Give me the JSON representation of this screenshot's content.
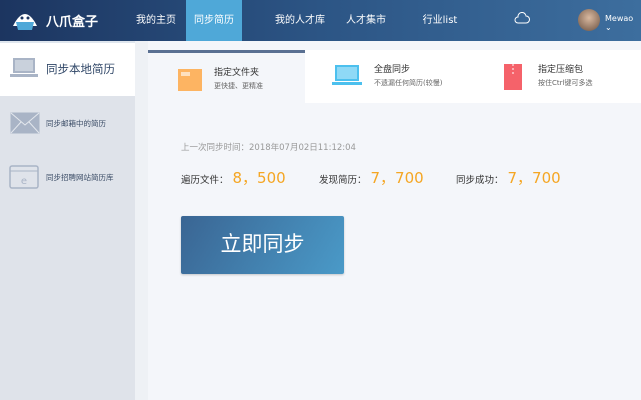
{
  "app": {
    "name": "八爪盒子"
  },
  "nav": [
    {
      "label": "我的主页"
    },
    {
      "label": "同步简历",
      "active": true
    },
    {
      "label": "我的人才库"
    },
    {
      "label": "人才集市"
    },
    {
      "label": "行业list"
    }
  ],
  "user": {
    "name": "Mewao"
  },
  "sidebar": {
    "title": "同步本地简历",
    "items": [
      {
        "label": "同步邮箱中的简历",
        "icon": "mail-icon"
      },
      {
        "label": "同步招聘网站简历库",
        "icon": "browser-icon"
      }
    ]
  },
  "tabs": [
    {
      "title": "指定文件夹",
      "subtitle": "更快捷、更精准",
      "icon": "folder-icon"
    },
    {
      "title": "全盘同步",
      "subtitle": "不遗漏任何简历(较慢)",
      "icon": "laptop-icon"
    },
    {
      "title": "指定压缩包",
      "subtitle": "按住Ctrl键可多选",
      "icon": "zip-icon"
    }
  ],
  "sync": {
    "last_time": "上一次同步时间：2018年07月02日11:12:04",
    "stats": [
      {
        "label": "遍历文件：",
        "value": "8，500"
      },
      {
        "label": "发现简历：",
        "value": "7，700"
      },
      {
        "label": "同步成功：",
        "value": "7，700"
      }
    ],
    "button": "立即同步"
  },
  "colors": {
    "accent": "#4fa8d8",
    "number": "#f5a623"
  }
}
